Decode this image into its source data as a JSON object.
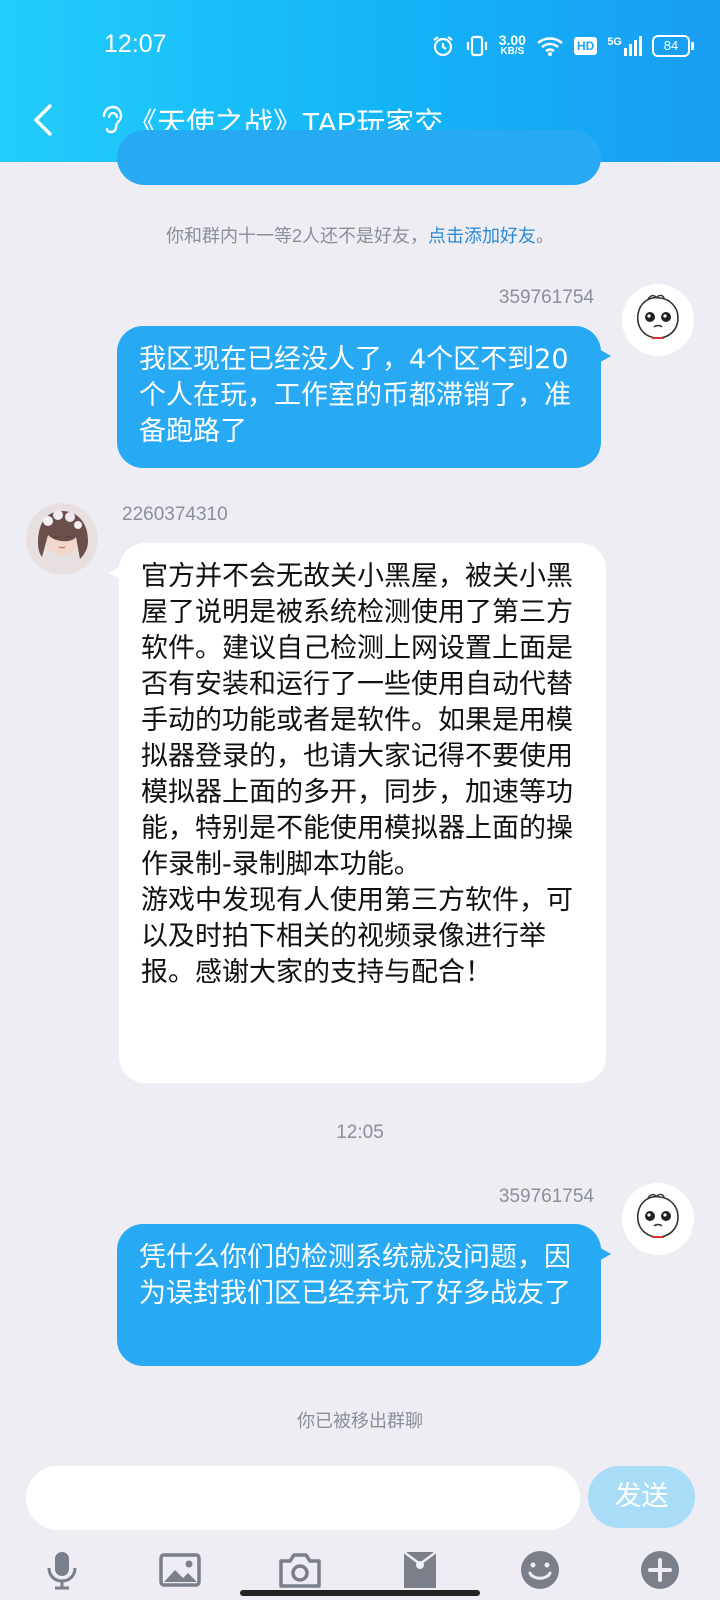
{
  "status_bar": {
    "time": "12:07",
    "net_speed_value": "3.00",
    "net_speed_unit": "KB/S",
    "hd": "HD",
    "network": "5G",
    "battery": "84"
  },
  "header": {
    "title": "《天使之战》TAP玩家交..."
  },
  "system_tip": {
    "text": "你和群内十一等2人还不是好友，",
    "link": "点击添加好友",
    "suffix": "。"
  },
  "messages": [
    {
      "sender": "359761754",
      "text": "我区现在已经没人了，4个区不到20个人在玩，工作室的币都滞销了，准备跑路了"
    },
    {
      "sender": "2260374310",
      "text": "官方并不会无故关小黑屋，被关小黑屋了说明是被系统检测使用了第三方软件。建议自己检测上网设置上面是否有安装和运行了一些使用自动代替手动的功能或者是软件。如果是用模拟器登录的，也请大家记得不要使用模拟器上面的多开，同步，加速等功能，特别是不能使用模拟器上面的操作录制-录制脚本功能。\n游戏中发现有人使用第三方软件，可以及时拍下相关的视频录像进行举报。感谢大家的支持与配合！"
    },
    {
      "sender": "359761754",
      "text": "凭什么你们的检测系统就没问题，因为误封我们区已经弃坑了好多战友了"
    }
  ],
  "timestamp": "12:05",
  "removed_notice": "你已被移出群聊",
  "input": {
    "placeholder": ""
  },
  "send_label": "发送",
  "colors": {
    "header_start": "#22cdfb",
    "header_end": "#1a9df3",
    "bubble_out": "#27a9f3",
    "bubble_in": "#ffffff",
    "background": "#ededf3",
    "link": "#2b8ad8"
  },
  "icons": [
    "back-arrow-icon",
    "ear-icon",
    "alarm-icon",
    "vibrate-icon",
    "wifi-icon",
    "signal-icon",
    "microphone-icon",
    "image-icon",
    "camera-icon",
    "red-packet-icon",
    "emoji-icon",
    "plus-icon"
  ]
}
